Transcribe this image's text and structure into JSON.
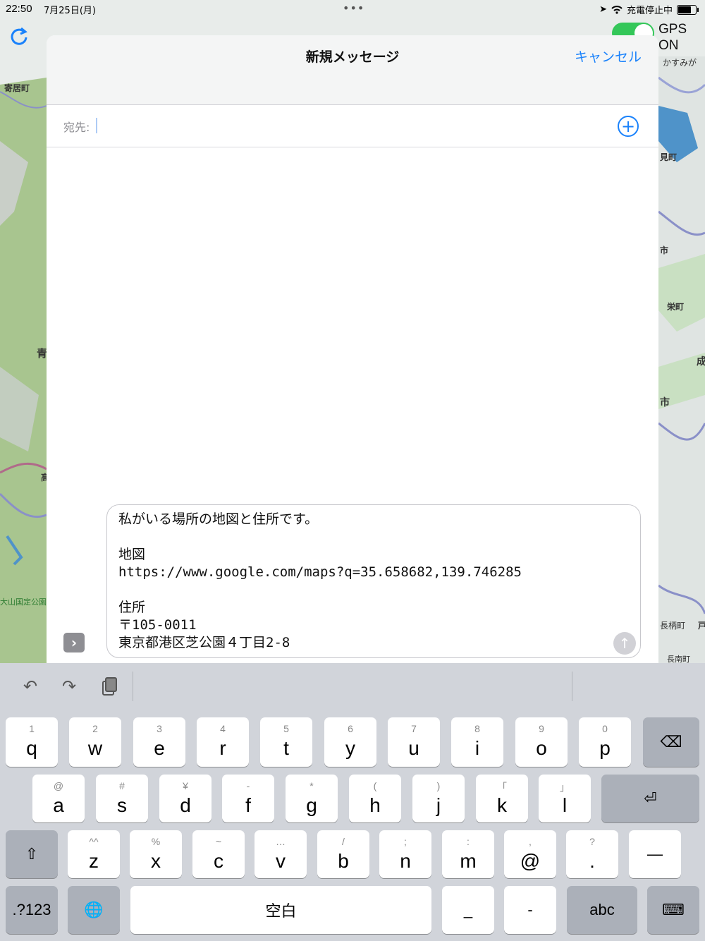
{
  "status_bar": {
    "time": "22:50",
    "date": "7月25日(月)",
    "charging": "充電停止中"
  },
  "map": {
    "labels": [
      "寄居町",
      "青",
      "高",
      "大山国定公園",
      "かすみが",
      "見町",
      "市",
      "栄町",
      "成",
      "市",
      "長柄町",
      "長南町",
      "戸"
    ],
    "gps_label": "GPS ON"
  },
  "compose": {
    "title": "新規メッセージ",
    "cancel_label": "キャンセル",
    "to_label": "宛先:",
    "to_value": "",
    "message": "私がいる場所の地図と住所です。\n\n地図\nhttps://www.google.com/maps?q=35.658682,139.746285\n\n住所\n〒105-0011\n東京都港区芝公園４丁目2-8"
  },
  "keyboard": {
    "row1": [
      {
        "sub": "1",
        "main": "q"
      },
      {
        "sub": "2",
        "main": "w"
      },
      {
        "sub": "3",
        "main": "e"
      },
      {
        "sub": "4",
        "main": "r"
      },
      {
        "sub": "5",
        "main": "t"
      },
      {
        "sub": "6",
        "main": "y"
      },
      {
        "sub": "7",
        "main": "u"
      },
      {
        "sub": "8",
        "main": "i"
      },
      {
        "sub": "9",
        "main": "o"
      },
      {
        "sub": "0",
        "main": "p"
      }
    ],
    "row2": [
      {
        "sub": "@",
        "main": "a"
      },
      {
        "sub": "#",
        "main": "s"
      },
      {
        "sub": "¥",
        "main": "d"
      },
      {
        "sub": "-",
        "main": "f"
      },
      {
        "sub": "*",
        "main": "g"
      },
      {
        "sub": "(",
        "main": "h"
      },
      {
        "sub": ")",
        "main": "j"
      },
      {
        "sub": "「",
        "main": "k"
      },
      {
        "sub": "」",
        "main": "l"
      }
    ],
    "row3": [
      {
        "sub": "^^",
        "main": "z"
      },
      {
        "sub": "%",
        "main": "x"
      },
      {
        "sub": "~",
        "main": "c"
      },
      {
        "sub": "…",
        "main": "v"
      },
      {
        "sub": "/",
        "main": "b"
      },
      {
        "sub": ";",
        "main": "n"
      },
      {
        "sub": ":",
        "main": "m"
      },
      {
        "sub": ",",
        "main": "@"
      },
      {
        "sub": "?",
        "main": "."
      }
    ],
    "row3_extra": "—",
    "numbers_label": ".?123",
    "space_label": "空白",
    "underscore_label": "_",
    "dash_label": "-",
    "abc_label": "abc"
  }
}
